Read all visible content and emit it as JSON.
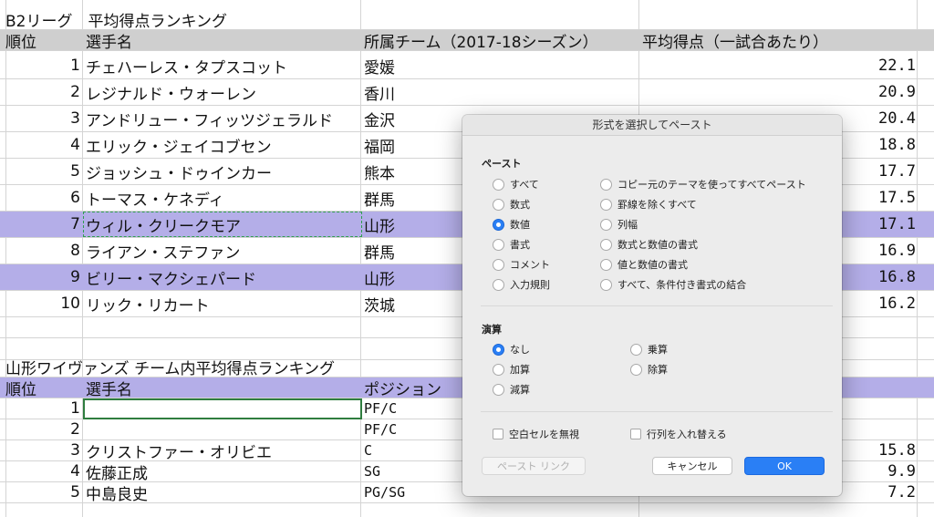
{
  "sheet": {
    "table1": {
      "title": "B2リーグ　平均得点ランキング",
      "headers": {
        "rank": "順位",
        "name": "選手名",
        "team": "所属チーム（2017-18シーズン）",
        "avg": "平均得点（一試合あたり）"
      },
      "rows": [
        {
          "rank": "1",
          "name": "チェハーレス・タプスコット",
          "team": "愛媛",
          "avg": "22.1"
        },
        {
          "rank": "2",
          "name": "レジナルド・ウォーレン",
          "team": "香川",
          "avg": "20.9"
        },
        {
          "rank": "3",
          "name": "アンドリュー・フィッツジェラルド",
          "team": "金沢",
          "avg": "20.4"
        },
        {
          "rank": "4",
          "name": "エリック・ジェイコブセン",
          "team": "福岡",
          "avg": "18.8"
        },
        {
          "rank": "5",
          "name": "ジョッシュ・ドゥインカー",
          "team": "熊本",
          "avg": "17.7"
        },
        {
          "rank": "6",
          "name": "トーマス・ケネディ",
          "team": "群馬",
          "avg": "17.5"
        },
        {
          "rank": "7",
          "name": "ウィル・クリークモア",
          "team": "山形",
          "avg": "17.1"
        },
        {
          "rank": "8",
          "name": "ライアン・ステファン",
          "team": "群馬",
          "avg": "16.9"
        },
        {
          "rank": "9",
          "name": "ビリー・マクシェパード",
          "team": "山形",
          "avg": "16.8"
        },
        {
          "rank": "10",
          "name": "リック・リカート",
          "team": "茨城",
          "avg": "16.2"
        }
      ]
    },
    "table2": {
      "title": "山形ワイヴァンズ チーム内平均得点ランキング",
      "headers": {
        "rank": "順位",
        "name": "選手名",
        "position": "ポジション"
      },
      "rows": [
        {
          "rank": "1",
          "name": "",
          "position": "PF/C",
          "avg": ""
        },
        {
          "rank": "2",
          "name": "",
          "position": "PF/C",
          "avg": ""
        },
        {
          "rank": "3",
          "name": "クリストファー・オリビエ",
          "position": "C",
          "avg": "15.8"
        },
        {
          "rank": "4",
          "name": "佐藤正成",
          "position": "SG",
          "avg": "9.9"
        },
        {
          "rank": "5",
          "name": "中島良史",
          "position": "PG/SG",
          "avg": "7.2"
        }
      ]
    },
    "colors": {
      "header_gray": "#cfcfcf",
      "highlight_purple": "#b4aee8",
      "copy_border": "#2f9e4f"
    }
  },
  "dialog": {
    "title": "形式を選択してペースト",
    "paste_section": "ペースト",
    "paste_left": [
      "すべて",
      "数式",
      "数値",
      "書式",
      "コメント",
      "入力規則"
    ],
    "paste_right": [
      "コピー元のテーマを使ってすべてペースト",
      "罫線を除くすべて",
      "列幅",
      "数式と数値の書式",
      "値と数値の書式",
      "すべて、条件付き書式の結合"
    ],
    "paste_selected": "数値",
    "operation_section": "演算",
    "op_left": [
      "なし",
      "加算",
      "減算"
    ],
    "op_right": [
      "乗算",
      "除算"
    ],
    "op_selected": "なし",
    "skip_blanks": "空白セルを無視",
    "transpose": "行列を入れ替える",
    "paste_link": "ペースト リンク",
    "cancel": "キャンセル",
    "ok": "OK",
    "accent": "#2a7ff5"
  }
}
